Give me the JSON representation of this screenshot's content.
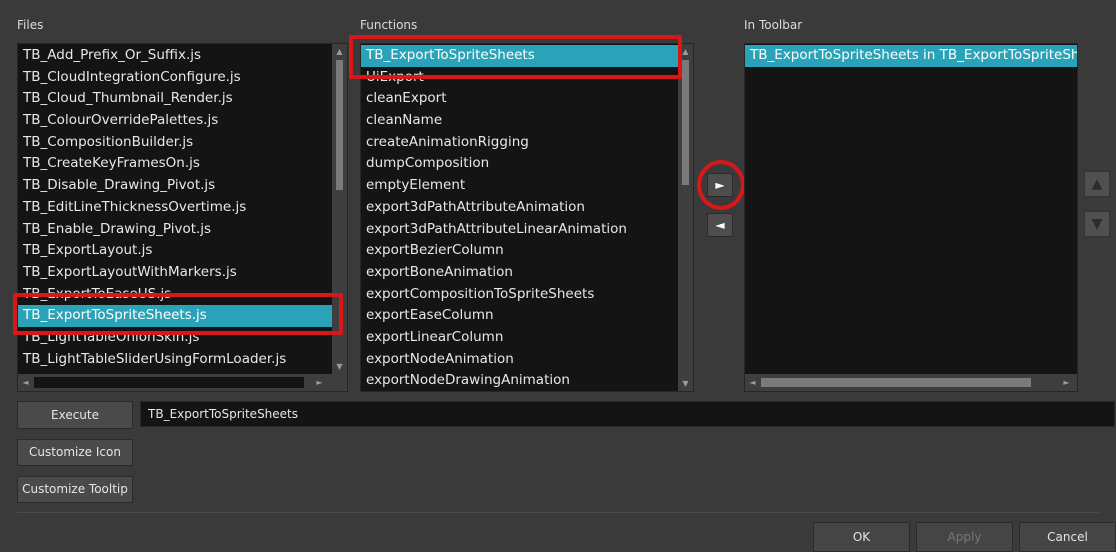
{
  "files": {
    "label": "Files",
    "items": [
      "TB_Add_Prefix_Or_Suffix.js",
      "TB_CloudIntegrationConfigure.js",
      "TB_Cloud_Thumbnail_Render.js",
      "TB_ColourOverridePalettes.js",
      "TB_CompositionBuilder.js",
      "TB_CreateKeyFramesOn.js",
      "TB_Disable_Drawing_Pivot.js",
      "TB_EditLineThicknessOvertime.js",
      "TB_Enable_Drawing_Pivot.js",
      "TB_ExportLayout.js",
      "TB_ExportLayoutWithMarkers.js",
      "TB_ExportToEaseUS.js",
      "TB_ExportToSpriteSheets.js",
      "TB_LightTableOnionSkin.js",
      "TB_LightTableSliderUsingFormLoader.js"
    ],
    "selected": "TB_ExportToSpriteSheets.js"
  },
  "functions": {
    "label": "Functions",
    "items": [
      "TB_ExportToSpriteSheets",
      "UiExport",
      "cleanExport",
      "cleanName",
      "createAnimationRigging",
      "dumpComposition",
      "emptyElement",
      "export3dPathAttributeAnimation",
      "export3dPathAttributeLinearAnimation",
      "exportBezierColumn",
      "exportBoneAnimation",
      "exportCompositionToSpriteSheets",
      "exportEaseColumn",
      "exportLinearColumn",
      "exportNodeAnimation",
      "exportNodeDrawingAnimation"
    ],
    "selected": "TB_ExportToSpriteSheets"
  },
  "toolbar": {
    "label": "In Toolbar",
    "items": [
      "TB_ExportToSpriteSheets in TB_ExportToSpriteShe"
    ],
    "selected": "TB_ExportToSpriteSheets in TB_ExportToSpriteShe"
  },
  "transfer": {
    "add_glyph": "►",
    "remove_glyph": "◄",
    "up_glyph": "▲",
    "down_glyph": "▼"
  },
  "scroll": {
    "up": "▲",
    "down": "▼",
    "left": "◄",
    "right": "►"
  },
  "actions": {
    "execute_label": "Execute",
    "execute_value": "TB_ExportToSpriteSheets",
    "customize_icon_label": "Customize Icon",
    "customize_tooltip_label": "Customize Tooltip"
  },
  "dialog": {
    "ok_label": "OK",
    "apply_label": "Apply",
    "cancel_label": "Cancel"
  },
  "colors": {
    "selection": "#2aa3b8",
    "highlight_annotation": "#d81818",
    "list_background": "#141414",
    "dialog_background": "#3a3a3a"
  }
}
